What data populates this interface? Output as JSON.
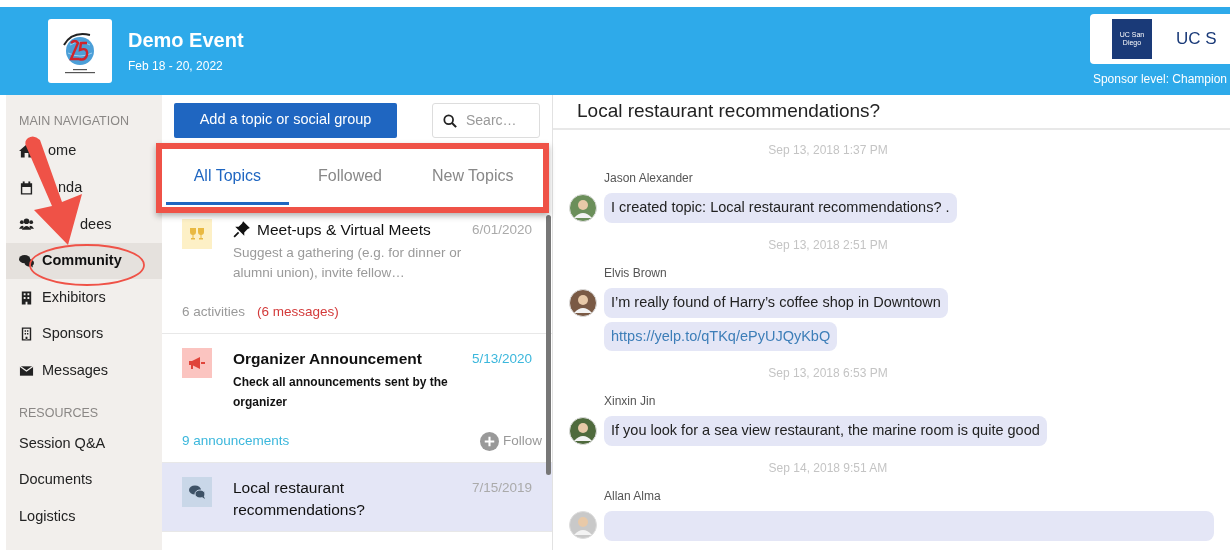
{
  "header": {
    "title": "Demo Event",
    "dates": "Feb 18 - 20, 2022",
    "sponsor": {
      "logo_text": "UC San Diego",
      "name": "UC S",
      "level": "Sponsor level: Champion"
    }
  },
  "sidebar": {
    "sections": [
      {
        "heading": "MAIN NAVIGATION",
        "items": [
          {
            "label": "ome",
            "kind": "home",
            "selected": false
          },
          {
            "label": "nda",
            "kind": "calendar",
            "selected": false
          },
          {
            "label": "dees",
            "kind": "people",
            "selected": false
          },
          {
            "label": "Community",
            "kind": "chat",
            "selected": true
          },
          {
            "label": "Exhibitors",
            "kind": "building",
            "selected": false
          },
          {
            "label": "Sponsors",
            "kind": "office",
            "selected": false
          },
          {
            "label": "Messages",
            "kind": "mail",
            "selected": false
          }
        ]
      },
      {
        "heading": "RESOURCES",
        "items": [
          {
            "label": "Session Q&A",
            "selected": false
          },
          {
            "label": "Documents",
            "selected": false
          },
          {
            "label": "Logistics",
            "selected": false
          }
        ]
      }
    ]
  },
  "topics": {
    "add_button": "Add a topic or social group",
    "search": {
      "placeholder": "Searc…"
    },
    "tabs": [
      {
        "label": "All Topics",
        "selected": true
      },
      {
        "label": "Followed",
        "selected": false
      },
      {
        "label": "New Topics",
        "selected": false
      }
    ],
    "items": [
      {
        "kind": "social",
        "pinned": true,
        "title": "Meet-ups & Virtual Meets",
        "date": "6/01/2020",
        "description": "Suggest a gathering (e.g. for dinner or alumni union), invite fellow…",
        "activities": "6 activities",
        "messages": "(6 messages)",
        "selected": false
      },
      {
        "kind": "announcement",
        "pinned": false,
        "title": "Organizer Announcement",
        "date": "5/13/2020",
        "description": "Check all announcements sent by the organizer",
        "announcements": "9 announcements",
        "follow": "Follow",
        "selected": false
      },
      {
        "kind": "discussion",
        "pinned": false,
        "title": "Local restaurant recommendations?",
        "date": "7/15/2019",
        "selected": true
      }
    ]
  },
  "chat": {
    "title": "Local restaurant recommendations?",
    "entries": [
      {
        "time": "Sep 13, 2018 1:37 PM",
        "author": "Jason Alexander",
        "bubbles": [
          {
            "kind": "text",
            "text": "I created topic: Local restaurant recommendations? ."
          }
        ]
      },
      {
        "time": "Sep 13, 2018 2:51 PM",
        "author": "Elvis Brown",
        "bubbles": [
          {
            "kind": "text",
            "text": "I’m really found of Harry’s coffee shop in Downtown"
          },
          {
            "kind": "link",
            "text": "https://yelp.to/qTKq/ePyUJQyKbQ"
          }
        ]
      },
      {
        "time": "Sep 13, 2018 6:53 PM",
        "author": "Xinxin Jin",
        "bubbles": [
          {
            "kind": "text",
            "text": "If you look for a sea view restaurant, the marine room is quite good"
          }
        ]
      },
      {
        "time": "Sep 14, 2018 9:51 AM",
        "author": "Allan Alma"
      }
    ]
  },
  "annotations": [
    {
      "kind": "arrow"
    },
    {
      "kind": "circle"
    },
    {
      "kind": "frame"
    }
  ]
}
